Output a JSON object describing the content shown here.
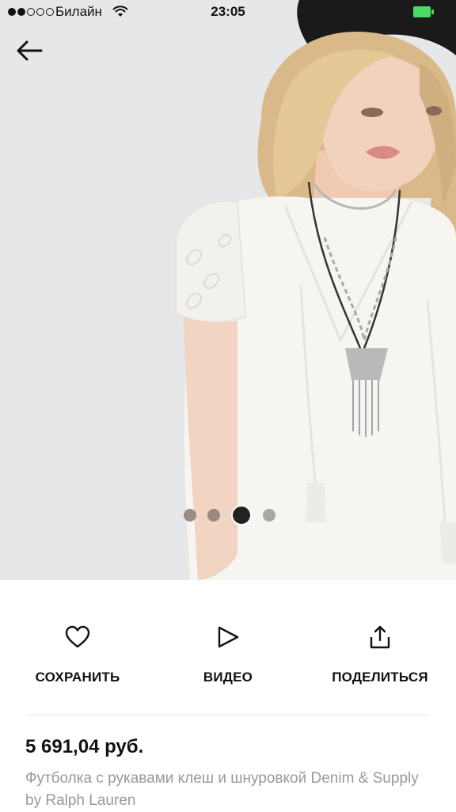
{
  "status_bar": {
    "carrier": "Билайн",
    "time": "23:05",
    "signal_bars_filled": 2,
    "signal_bars_total": 5,
    "battery_color": "#4cd964"
  },
  "gallery": {
    "page_count": 4,
    "active_index": 2
  },
  "actions": {
    "save_label": "СОХРАНИТЬ",
    "video_label": "ВИДЕО",
    "share_label": "ПОДЕЛИТЬСЯ"
  },
  "product": {
    "price": "5 691,04 руб.",
    "title": "Футболка с рукавами клеш и шнуровкой Denim & Supply by Ralph Lauren"
  }
}
